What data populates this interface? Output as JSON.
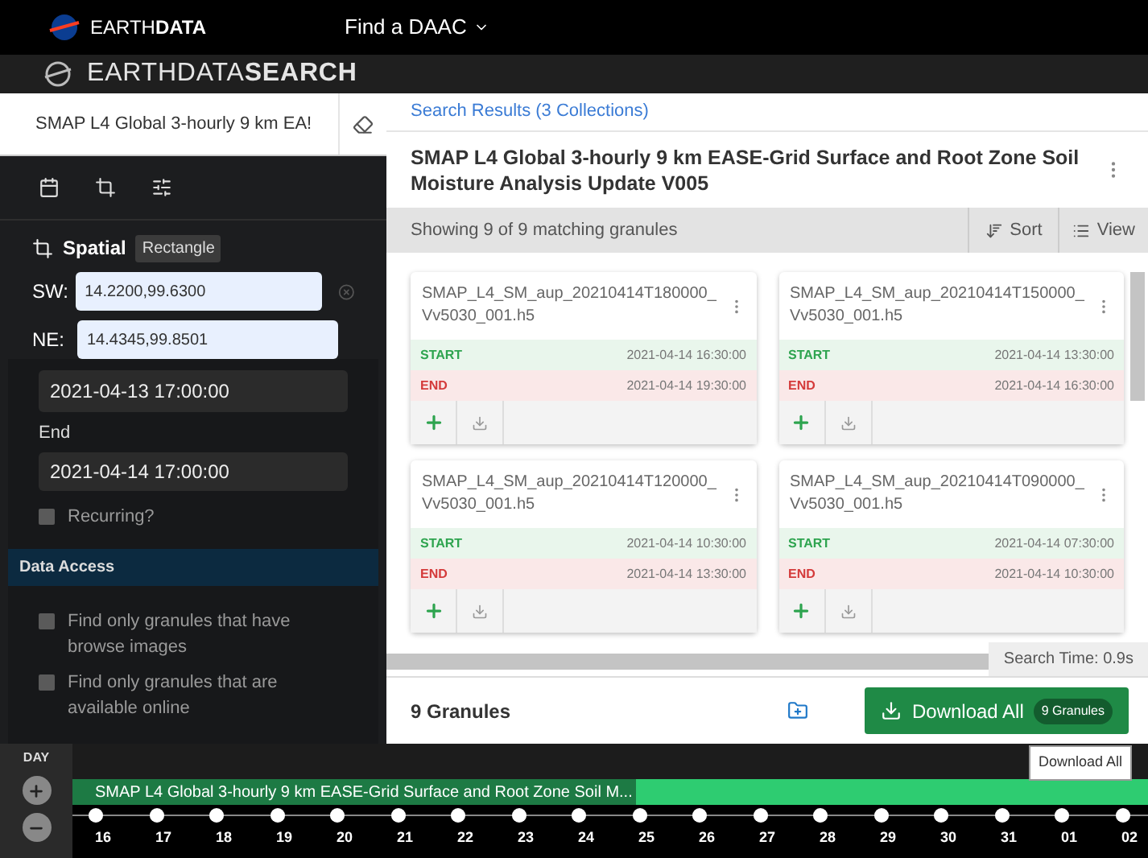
{
  "top_bar": {
    "brand_light": "EARTH",
    "brand_bold": "DATA",
    "menu": "Find a DAAC"
  },
  "app_bar": {
    "brand_light": "EARTHDATA",
    "brand_bold": "SEARCH"
  },
  "sidebar": {
    "search_value": "SMAP L4 Global 3-hourly 9 km EA!",
    "tabs": [
      {
        "kind": "calendar",
        "selected": false
      },
      {
        "kind": "crop",
        "selected": false
      },
      {
        "kind": "sliders",
        "selected": false
      }
    ],
    "spatial": {
      "label": "Spatial",
      "type": "Rectangle",
      "sw_label": "SW:",
      "sw_value": "14.2200,99.6300",
      "ne_label": "NE:",
      "ne_value": "14.4345,99.8501"
    },
    "start_value": "2021-04-13 17:00:00",
    "end_label": "End",
    "end_value": "2021-04-14 17:00:00",
    "recurring": {
      "label": "Recurring?",
      "checked": false
    },
    "data_access": {
      "title": "Data Access",
      "options": [
        {
          "label": "Find only granules that have browse images",
          "checked": false
        },
        {
          "label": "Find only granules that are available online",
          "checked": false
        }
      ]
    }
  },
  "results": {
    "breadcrumb": "Search Results (3 Collections)",
    "title": "SMAP L4 Global 3-hourly 9 km EASE-Grid Surface and Root Zone Soil Moisture Analysis Update V005",
    "showing": "Showing 9 of 9 matching granules",
    "sort": "Sort",
    "view": "View",
    "granules": [
      {
        "name": "SMAP_L4_SM_aup_20210414T180000_Vv5030_001.h5",
        "start_label": "START",
        "start": "2021-04-14 16:30:00",
        "end_label": "END",
        "end": "2021-04-14 19:30:00"
      },
      {
        "name": "SMAP_L4_SM_aup_20210414T150000_Vv5030_001.h5",
        "start_label": "START",
        "start": "2021-04-14 13:30:00",
        "end_label": "END",
        "end": "2021-04-14 16:30:00"
      },
      {
        "name": "SMAP_L4_SM_aup_20210414T120000_Vv5030_001.h5",
        "start_label": "START",
        "start": "2021-04-14 10:30:00",
        "end_label": "END",
        "end": "2021-04-14 13:30:00"
      },
      {
        "name": "SMAP_L4_SM_aup_20210414T090000_Vv5030_001.h5",
        "start_label": "START",
        "start": "2021-04-14 07:30:00",
        "end_label": "END",
        "end": "2021-04-14 10:30:00"
      }
    ],
    "search_time": "Search Time: 0.9s",
    "count": "9 Granules",
    "download": "Download All",
    "download_badge": "9 Granules",
    "tooltip": "Download All"
  },
  "timeline": {
    "zoom": "DAY",
    "track_label": "SMAP L4 Global 3-hourly 9 km EASE-Grid Surface and Root Zone Soil M...",
    "days": [
      "16",
      "17",
      "18",
      "19",
      "20",
      "21",
      "22",
      "23",
      "24",
      "25",
      "26",
      "27",
      "28",
      "29",
      "30",
      "31",
      "01",
      "02"
    ]
  }
}
